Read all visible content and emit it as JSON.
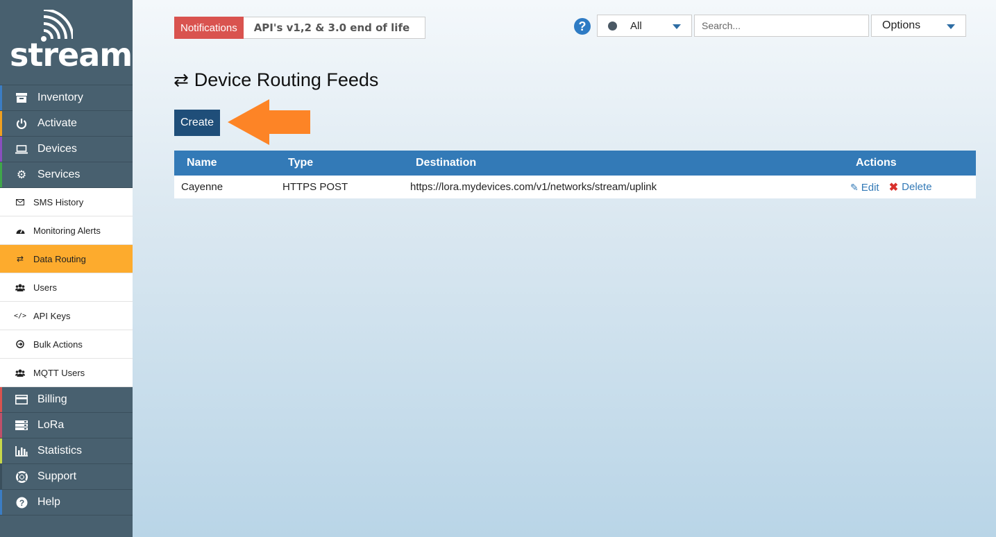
{
  "brand": {
    "logo_text": "stream"
  },
  "sidebar": {
    "main_items": [
      {
        "label": "Inventory",
        "icon": "archive-icon",
        "accent": "#3b7dc4"
      },
      {
        "label": "Activate",
        "icon": "power-icon",
        "accent": "#f0a020"
      },
      {
        "label": "Devices",
        "icon": "laptop-icon",
        "accent": "#8a4fbf"
      },
      {
        "label": "Services",
        "icon": "gear-icon",
        "accent": "#3fa64a"
      }
    ],
    "service_items": [
      {
        "label": "SMS History",
        "icon": "envelope-icon"
      },
      {
        "label": "Monitoring Alerts",
        "icon": "dashboard-icon"
      },
      {
        "label": "Data Routing",
        "icon": "exchange-icon",
        "active": true
      },
      {
        "label": "Users",
        "icon": "users-icon"
      },
      {
        "label": "API Keys",
        "icon": "code-icon"
      },
      {
        "label": "Bulk Actions",
        "icon": "circle-arrow-icon"
      },
      {
        "label": "MQTT Users",
        "icon": "users-icon"
      }
    ],
    "bottom_items": [
      {
        "label": "Billing",
        "icon": "credit-card-icon",
        "accent": "#d9534f"
      },
      {
        "label": "LoRa",
        "icon": "server-icon",
        "accent": "#c0506a"
      },
      {
        "label": "Statistics",
        "icon": "bar-chart-icon",
        "accent": "#c8d84a"
      },
      {
        "label": "Support",
        "icon": "life-ring-icon",
        "accent": "#3a4f5c"
      },
      {
        "label": "Help",
        "icon": "question-icon",
        "accent": "#3b7dc4"
      }
    ]
  },
  "topbar": {
    "notifications_label": "Notifications",
    "notification_text": "API's v1,2 & 3.0 end of life",
    "status_filter": "All",
    "search_placeholder": "Search...",
    "options_label": "Options"
  },
  "main": {
    "title": "Device Routing Feeds",
    "create_label": "Create",
    "table": {
      "headers": [
        "Name",
        "Type",
        "Destination",
        "Actions"
      ],
      "rows": [
        {
          "name": "Cayenne",
          "type": "HTTPS POST",
          "destination": "https://lora.mydevices.com/v1/networks/stream/uplink",
          "edit": "Edit",
          "delete": "Delete"
        }
      ]
    }
  },
  "colors": {
    "sidebar": "#48606f",
    "active_item": "#fdab2d",
    "table_header": "#337ab7",
    "create_button": "#1f4e79",
    "arrow": "#fd8426",
    "badge": "#d9534f"
  }
}
